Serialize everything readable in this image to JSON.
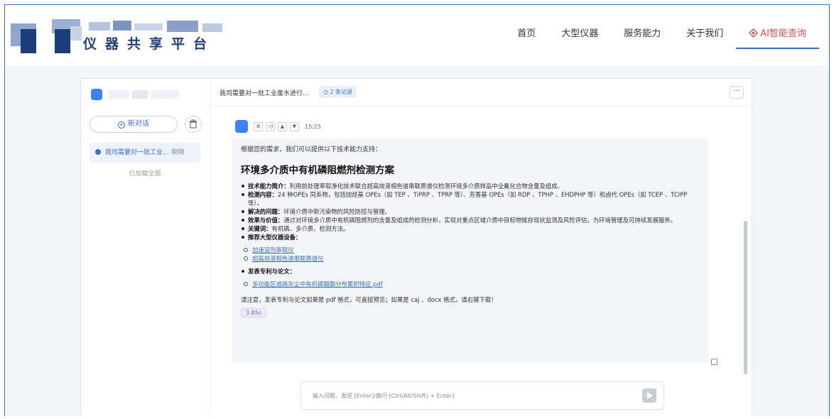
{
  "header": {
    "brand": "仪器共享平台",
    "nav": [
      {
        "label": "首页"
      },
      {
        "label": "大型仪器"
      },
      {
        "label": "服务能力"
      },
      {
        "label": "关于我们"
      },
      {
        "label": "AI智能查询",
        "active": true
      }
    ]
  },
  "sidebar": {
    "new_chat_label": "新对话",
    "history": [
      {
        "title": "我司需要对一批工业...",
        "time": "刚刚"
      }
    ],
    "loaded_all": "已加载全部"
  },
  "chat": {
    "title": "我司需要对一批工业废水进行...",
    "records_label": "2 条记录",
    "more_label": "···",
    "message": {
      "time": "15:25",
      "intro": "根据您的需求，我们可以提供以下技术能力支持：",
      "solution_title": "环境多介质中有机磷阻燃剂检测方案",
      "items": [
        {
          "label": "技术能力简介：",
          "text": "利用前处理萃取净化技术联合超高效液相色谱串联质谱仪检测环境多介质样品中全氟化合物含量及组成。"
        },
        {
          "label": "检测内容：",
          "text": "24 种OPEs 同系物，包括烷烃基 OPEs（如 TEP 、TiPRP 、TPRP 等）、芳香基 OPEs（如 RDP 、TPHP 、EHDPHP 等）和卤代 OPEs（如 TCEP 、TCIPP 等）。"
        },
        {
          "label": "解决的问题：",
          "text": "环境介质中新污染物的风险防控与管理。"
        },
        {
          "label": "效果与价值：",
          "text": "通过对环境多介质中有机磷阻燃剂的含量及组成的检测分析，实现对重点区域介质中目标物赋存现状监测及风险评估，为环境管理及可持续发展服务。"
        },
        {
          "label": "关键词：",
          "text": "有机磷、多介质、检测方法。"
        },
        {
          "label": "推荐大型仪器设备：",
          "text": ""
        }
      ],
      "instruments": [
        "加速溶剂萃取仪",
        "超高效液相色谱串联质谱仪"
      ],
      "papers_label": "发表专利与论文：",
      "papers": [
        "多功能区道路灰尘中有机磷酸酯分布累积特征.pdf"
      ],
      "note": "请注意，发表专利与论文如果是 pdf 格式，可直接预览；如果是 caj 、docx 格式，请右键下载！",
      "duration": "3.85s"
    },
    "input_placeholder": "输入问题，发送 [Enter]/换行 [Ctrl(Alt/Shift) + Enter]"
  },
  "colors": {
    "accent": "#3a6fc4",
    "ai_active": "#d9534f",
    "brand": "#1f3f7a"
  }
}
